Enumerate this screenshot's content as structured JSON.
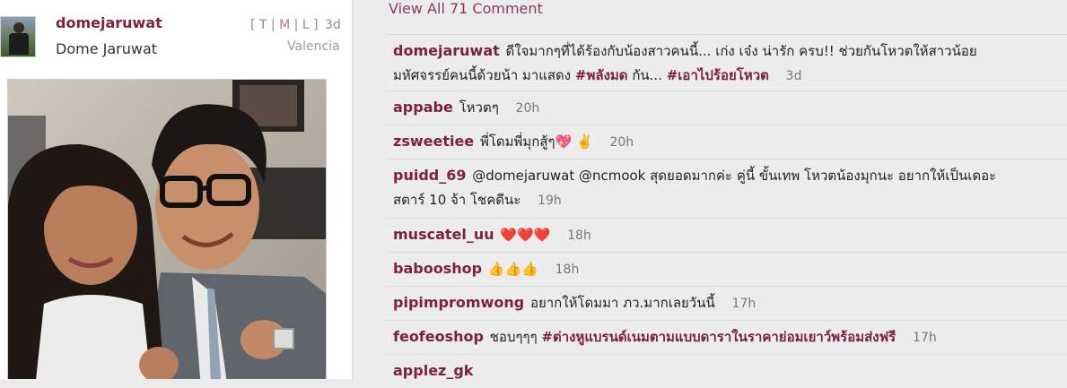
{
  "post": {
    "username": "domejaruwat",
    "full_name": "Dome Jaruwat",
    "sizes": [
      "T",
      "M",
      "L"
    ],
    "time": "3d",
    "location": "Valencia"
  },
  "comments_header": {
    "view_all": "View All 71 Comment"
  },
  "comments": [
    {
      "user": "domejaruwat",
      "line1": "ดีใจมากๆที่ได้ร้องกับน้องสาวคนนี้... เก่ง เจ๋ง น่ารัก ครบ!! ช่วยกันโหวตให้สาวน้อย",
      "line2": "มหัศจรรย์คนนี้ด้วยน้า มาแสดง",
      "tag1": "#พลังมด",
      "mid": "กัน...",
      "tag2": "#เอาไปร้อยโหวต",
      "time": "3d"
    },
    {
      "user": "appabe",
      "text": "โหวตๆ",
      "time": "20h"
    },
    {
      "user": "zsweetiee",
      "text": "พี่โดมพี่มุกสู้ๆ💖 ✌️",
      "time": "20h"
    },
    {
      "user": "puidd_69",
      "line1": "@domejaruwat @ncmook สุดยอดมากค่ะ คู่นี้ ขั้นเทพ โหวตน้องมุกนะ อยากให้เป็นเดอะ",
      "line2": "สตาร์ 10 จ้า โชคดีนะ",
      "time": "19h"
    },
    {
      "user": "muscatel_uu",
      "text": "❤️❤️❤️",
      "time": "18h"
    },
    {
      "user": "babooshop",
      "text": "👍👍👍",
      "time": "18h"
    },
    {
      "user": "pipimpromwong",
      "text": "อยากให้โดมมา ภว.มากเลยวันนี้",
      "time": "17h"
    },
    {
      "user": "feofeoshop",
      "text": "ชอบๆๆๆ",
      "tag": "#ต่างหูแบรนด์เนมตามแบบดาราในราคาย่อมเยาว์พร้อมส่งฟรี",
      "time": "17h"
    },
    {
      "user": "applez_gk",
      "text": ""
    }
  ]
}
